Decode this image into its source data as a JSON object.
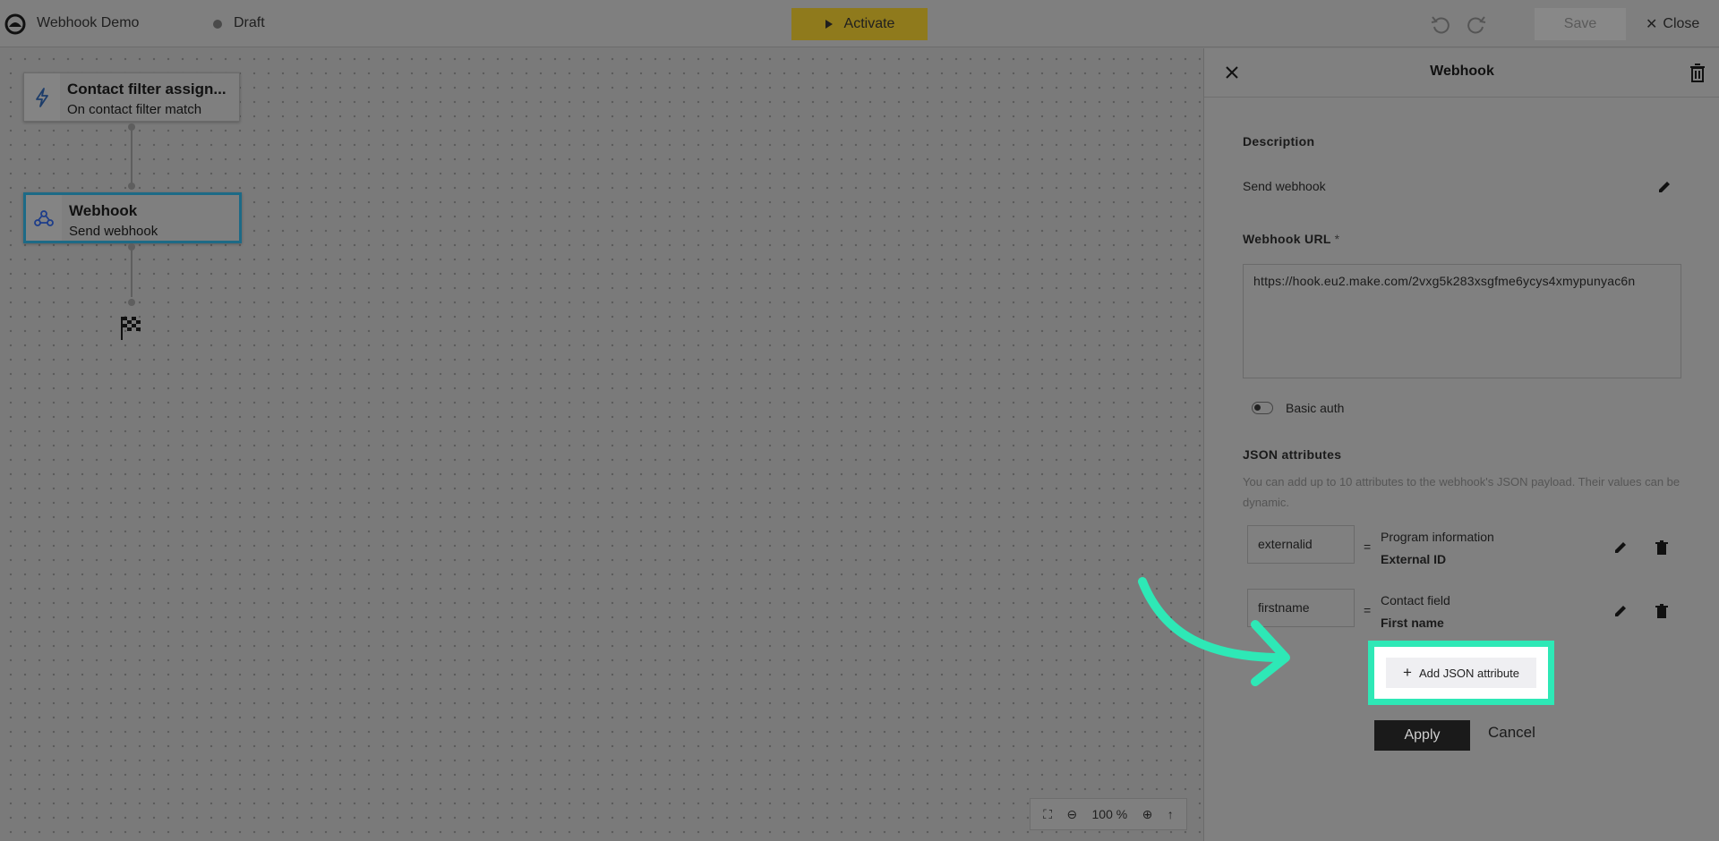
{
  "topbar": {
    "app_title": "Webhook Demo",
    "status": "Draft",
    "activate_label": "Activate",
    "save_label": "Save",
    "close_label": "Close"
  },
  "flow": {
    "trigger": {
      "title": "Contact filter assign...",
      "subtitle": "On contact filter match"
    },
    "webhook": {
      "title": "Webhook",
      "subtitle": "Send webhook"
    }
  },
  "zoom": {
    "level": "100 %"
  },
  "panel": {
    "title": "Webhook",
    "description_label": "Description",
    "description_value": "Send webhook",
    "url_label": "Webhook URL",
    "url_required_mark": "*",
    "url_value": "https://hook.eu2.make.com/2vxg5k283xsgfme6ycys4xmypunyac6n",
    "basic_auth_label": "Basic auth",
    "json_label": "JSON attributes",
    "json_help": "You can add up to 10 attributes to the webhook's JSON payload. Their values can be dynamic.",
    "attributes": [
      {
        "key": "externalid",
        "type": "Program information",
        "name": "External ID"
      },
      {
        "key": "firstname",
        "type": "Contact field",
        "name": "First name"
      }
    ],
    "equals": "=",
    "add_json_label": "Add JSON attribute",
    "apply_label": "Apply",
    "cancel_label": "Cancel"
  },
  "colors": {
    "highlight": "#2ee8b6",
    "activate": "#f5c518",
    "webhook_border": "#1d6a86"
  }
}
